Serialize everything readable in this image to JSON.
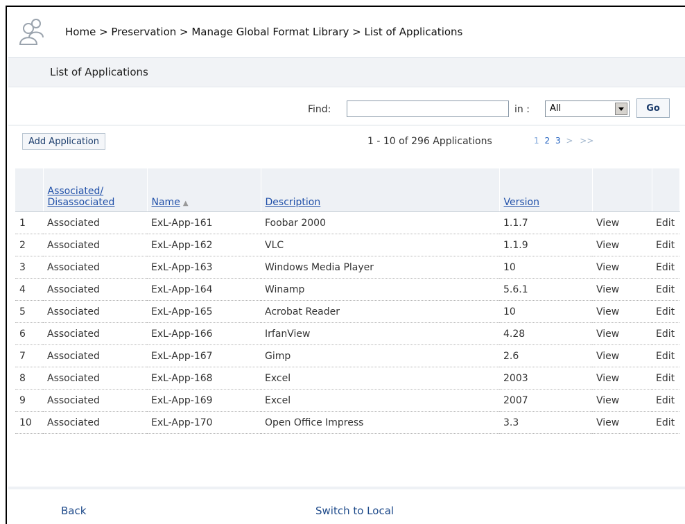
{
  "breadcrumb": "Home > Preservation > Manage Global Format Library > List of Applications",
  "page_title": "List of Applications",
  "find": {
    "label": "Find:",
    "value": "",
    "in_label": "in :",
    "scope_selected": "All",
    "go_label": "Go"
  },
  "toolbar": {
    "add_label": "Add Application",
    "pager_info": "1 - 10 of 296 Applications",
    "pages": [
      "1",
      "2",
      "3"
    ],
    "next": ">",
    "last": ">>"
  },
  "table": {
    "headers": [
      "",
      "Associated/ Disassociated",
      "Name",
      "Description",
      "Version",
      "",
      ""
    ],
    "rows": [
      {
        "num": "1",
        "status": "Associated",
        "name": "ExL-App-161",
        "description": "Foobar 2000",
        "version": "1.1.7",
        "view": "View",
        "edit": "Edit"
      },
      {
        "num": "2",
        "status": "Associated",
        "name": "ExL-App-162",
        "description": "VLC",
        "version": "1.1.9",
        "view": "View",
        "edit": "Edit"
      },
      {
        "num": "3",
        "status": "Associated",
        "name": "ExL-App-163",
        "description": "Windows Media Player",
        "version": "10",
        "view": "View",
        "edit": "Edit"
      },
      {
        "num": "4",
        "status": "Associated",
        "name": "ExL-App-164",
        "description": "Winamp",
        "version": "5.6.1",
        "view": "View",
        "edit": "Edit"
      },
      {
        "num": "5",
        "status": "Associated",
        "name": "ExL-App-165",
        "description": "Acrobat Reader",
        "version": "10",
        "view": "View",
        "edit": "Edit"
      },
      {
        "num": "6",
        "status": "Associated",
        "name": "ExL-App-166",
        "description": "IrfanView",
        "version": "4.28",
        "view": "View",
        "edit": "Edit"
      },
      {
        "num": "7",
        "status": "Associated",
        "name": "ExL-App-167",
        "description": "Gimp",
        "version": "2.6",
        "view": "View",
        "edit": "Edit"
      },
      {
        "num": "8",
        "status": "Associated",
        "name": "ExL-App-168",
        "description": "Excel",
        "version": "2003",
        "view": "View",
        "edit": "Edit"
      },
      {
        "num": "9",
        "status": "Associated",
        "name": "ExL-App-169",
        "description": "Excel",
        "version": "2007",
        "view": "View",
        "edit": "Edit"
      },
      {
        "num": "10",
        "status": "Associated",
        "name": "ExL-App-170",
        "description": "Open Office Impress",
        "version": "3.3",
        "view": "View",
        "edit": "Edit"
      }
    ]
  },
  "footer": {
    "back_label": "Back",
    "switch_label": "Switch to Local"
  },
  "colors": {
    "link": "#1f5fbf",
    "header_bg": "#eef1f5",
    "subheader_bg": "#f1f3f6"
  },
  "icons": {
    "header": "users-group-icon",
    "sort": "sort-ascending-icon",
    "dropdown": "chevron-down-icon"
  }
}
